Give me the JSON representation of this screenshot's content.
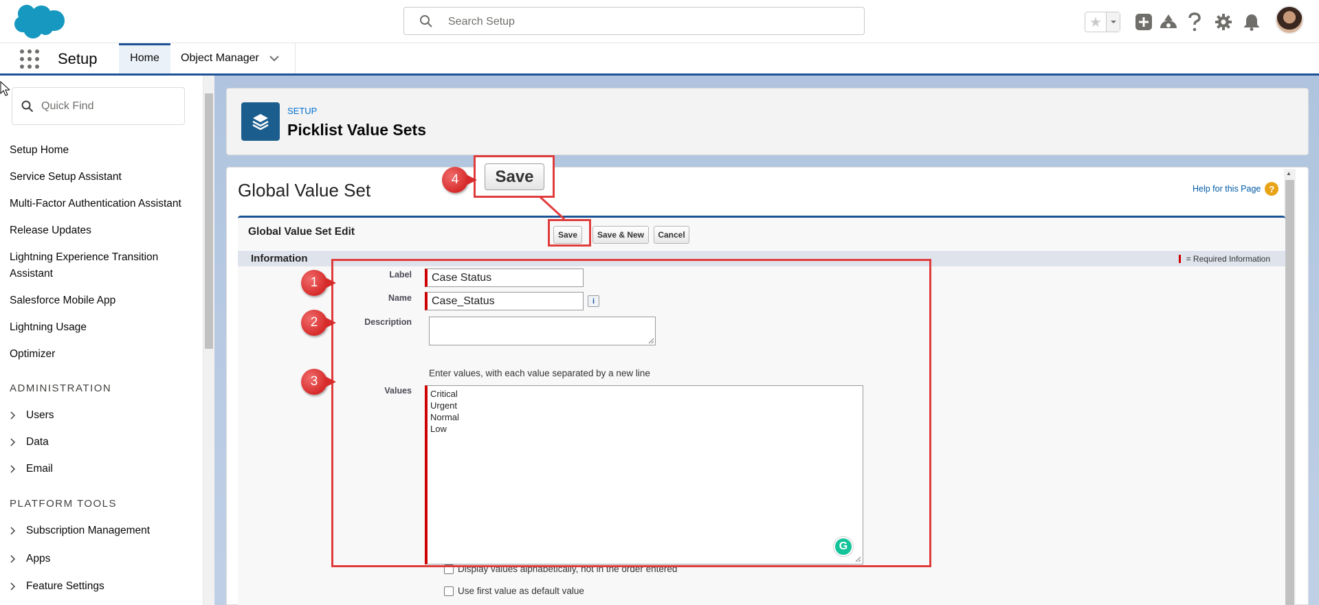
{
  "header": {
    "search_placeholder": "Search Setup",
    "icons": [
      "salesforce-cloud-logo",
      "search-icon",
      "favorites-star-icon",
      "favorites-dropdown-icon",
      "add-icon",
      "trailhead-icon",
      "help-icon",
      "gear-icon",
      "bell-icon",
      "avatar"
    ]
  },
  "nav": {
    "app_name": "Setup",
    "tabs": [
      {
        "label": "Home",
        "active": true
      },
      {
        "label": "Object Manager",
        "active": false
      }
    ]
  },
  "sidebar": {
    "quick_find_placeholder": "Quick Find",
    "items": [
      "Setup Home",
      "Service Setup Assistant",
      "Multi-Factor Authentication Assistant",
      "Release Updates",
      "Lightning Experience Transition",
      "Assistant",
      "Salesforce Mobile App",
      "Lightning Usage",
      "Optimizer"
    ],
    "sections": [
      {
        "heading": "ADMINISTRATION",
        "items": [
          "Users",
          "Data",
          "Email"
        ]
      },
      {
        "heading": "PLATFORM TOOLS",
        "items": [
          "Subscription Management",
          "Apps",
          "Feature Settings"
        ]
      }
    ]
  },
  "page_header": {
    "eyebrow": "SETUP",
    "title": "Picklist Value Sets"
  },
  "content": {
    "title": "Global Value Set",
    "help_link": "Help for this Page",
    "help_icon": "?",
    "edit_title": "Global Value Set Edit",
    "buttons": {
      "save": "Save",
      "save_new": "Save & New",
      "cancel": "Cancel"
    },
    "section_title": "Information",
    "required_info": "= Required Information",
    "fields": {
      "label": {
        "label": "Label",
        "value": "Case Status"
      },
      "name": {
        "label": "Name",
        "value": "Case_Status",
        "info_icon": "i"
      },
      "description": {
        "label": "Description",
        "value": ""
      },
      "values": {
        "label": "Values",
        "hint": "Enter values, with each value separated by a new line",
        "lines": [
          "Critical",
          "Urgent",
          "Normal",
          "Low"
        ]
      }
    },
    "checkboxes": [
      {
        "label": "Display values alphabetically, not in the order entered",
        "checked": false
      },
      {
        "label": "Use first value as default value",
        "checked": false
      }
    ]
  },
  "annotations": {
    "callout_save_label": "Save",
    "badges": [
      "1",
      "2",
      "3",
      "4"
    ],
    "accent_color": "#e03b3b"
  },
  "colors": {
    "brand_blue": "#1b5297",
    "link_blue": "#0070d2",
    "required_red": "#cc0000"
  }
}
